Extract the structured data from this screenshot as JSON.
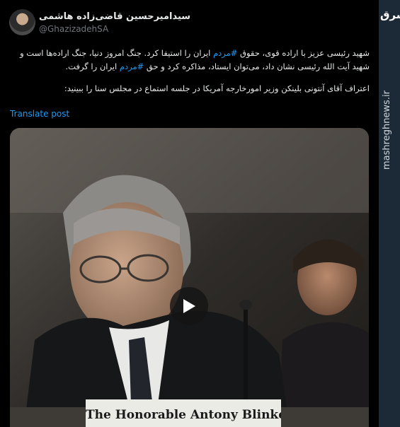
{
  "tweet": {
    "author": {
      "name": "سیدامیرحسین قاضی‌زاده هاشمی",
      "handle": "@GhazizadehSA"
    },
    "text_line1": {
      "part1": "شهید رئیسی عزیز با اراده قوی، حقوق ",
      "hashtag1": "#مردم",
      "part2": " ایران را استیفا کرد. جنگ امروز دنیا، جنگ اراده‌ها است و شهید آیت الله رئیسی نشان داد، می‌توان ایستاد، مذاکره کرد و حق ",
      "hashtag2": "#مردم",
      "part3": " ایران را گرفت."
    },
    "text_line2": "اعتراف آقای آنتونی بلینکن وزیر امورخارجه آمریکا در جلسه استماع در مجلس سنا را ببینید:",
    "translate_label": "Translate post",
    "media": {
      "nameplate": "The Honorable Antony Blinken",
      "play_icon": "play-icon"
    }
  },
  "watermark": {
    "logo_text": "مشرق",
    "site": "mashreghnews.ir"
  }
}
